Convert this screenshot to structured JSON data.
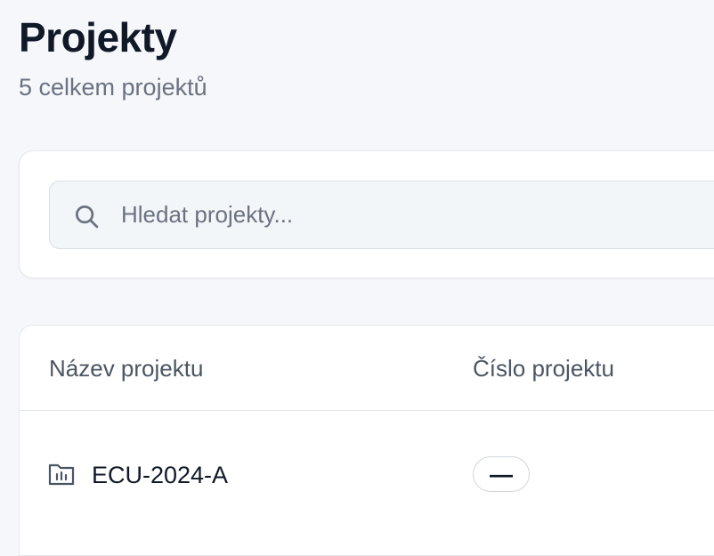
{
  "header": {
    "title": "Projekty",
    "subtitle": "5 celkem projektů"
  },
  "search": {
    "placeholder": "Hledat projekty...",
    "value": "",
    "icon": "search-icon"
  },
  "table": {
    "columns": [
      "Název projektu",
      "Číslo projektu"
    ],
    "rows": [
      {
        "icon": "folder-icon",
        "name": "ECU-2024-A",
        "number": "—"
      }
    ]
  },
  "colors": {
    "background": "#f5f7fa",
    "card": "#ffffff",
    "border": "#e5e7eb",
    "text_primary": "#111827",
    "text_muted": "#6b7280"
  }
}
